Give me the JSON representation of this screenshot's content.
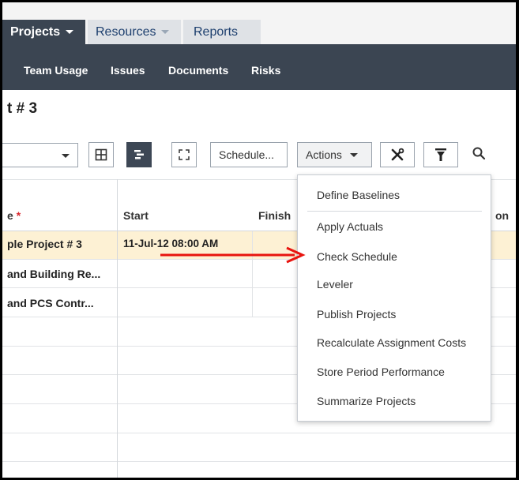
{
  "tabs": {
    "projects": "Projects",
    "resources": "Resources",
    "reports": "Reports"
  },
  "subnav": [
    "Team Usage",
    "Issues",
    "Documents",
    "Risks"
  ],
  "page_title": "t # 3",
  "toolbar": {
    "schedule_label": "Schedule...",
    "actions_label": "Actions"
  },
  "columns": {
    "name": "e",
    "required_marker": "*",
    "start": "Start",
    "finish": "Finish",
    "partial": "on"
  },
  "rows": [
    {
      "name": "ple Project # 3",
      "start": "11-Jul-12 08:00 AM"
    },
    {
      "name": "and Building Re...",
      "start": ""
    },
    {
      "name": "and PCS Contr...",
      "start": ""
    }
  ],
  "actions_menu": [
    "Define Baselines",
    "Apply Actuals",
    "Check Schedule",
    "Leveler",
    "Publish Projects",
    "Recalculate Assignment Costs",
    "Store Period Performance",
    "Summarize Projects"
  ],
  "colors": {
    "nav_dark": "#3b4552",
    "highlight_row": "#fdf1d4",
    "required": "#d9262c",
    "annotation_arrow": "#e8140f"
  }
}
